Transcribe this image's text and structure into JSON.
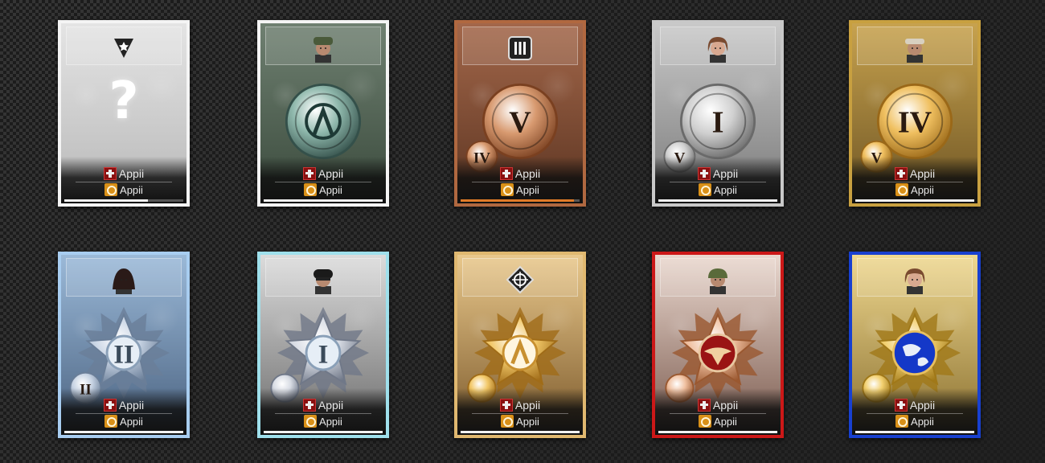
{
  "player_name": "Appii",
  "cards": [
    {
      "id": "unknown",
      "border": "#f4f4f4",
      "bg": [
        "#e4e4e4",
        "#b8b8b8"
      ],
      "header_icon": "faction-star-icon",
      "medal": "unknown",
      "main_numeral": "",
      "sub_numeral": "",
      "question_mark": "?",
      "progress": 0.7,
      "progress_color": "#f2f2f2"
    },
    {
      "id": "green-a",
      "border": "#f4f4f4",
      "bg": [
        "#6f8071",
        "#3a4a3c"
      ],
      "header_icon": "skull-soldier-portrait-icon",
      "medal": "coin-teal",
      "main_numeral": "",
      "sub_numeral": "",
      "progress": 1.0,
      "progress_color": "#f2f2f2"
    },
    {
      "id": "bronze-v",
      "border": "#b06840",
      "bg": [
        "#a3674a",
        "#5c3522"
      ],
      "header_icon": "ammo-icon",
      "medal": "coin-bronze",
      "main_numeral": "V",
      "sub_numeral": "IV",
      "progress": 0.95,
      "progress_color": "#e07a28"
    },
    {
      "id": "silver-i",
      "border": "#c8c8c8",
      "bg": [
        "#c9c9c9",
        "#7a7a7a"
      ],
      "header_icon": "female-soldier-portrait-icon",
      "medal": "coin-silver",
      "main_numeral": "I",
      "sub_numeral": "V",
      "progress": 1.0,
      "progress_color": "#f2f2f2"
    },
    {
      "id": "gold-iv",
      "border": "#c8a040",
      "bg": [
        "#c7a24e",
        "#6e5524"
      ],
      "header_icon": "bandana-soldier-portrait-icon",
      "medal": "coin-gold",
      "main_numeral": "IV",
      "sub_numeral": "V",
      "progress": 1.0,
      "progress_color": "#f2f2f2"
    },
    {
      "id": "blue-ii",
      "border": "#a8cdf0",
      "bg": [
        "#9bb9d8",
        "#4a6280"
      ],
      "header_icon": "hooded-soldier-portrait-icon",
      "medal": "star-silver-blue",
      "main_numeral": "II",
      "sub_numeral": "II",
      "progress": 1.0,
      "progress_color": "#f2f2f2"
    },
    {
      "id": "cyan-i",
      "border": "#9fe0ec",
      "bg": [
        "#dcdcdc",
        "#6c6c6c"
      ],
      "header_icon": "masked-soldier-portrait-icon",
      "medal": "star-silver",
      "main_numeral": "I",
      "sub_numeral": "",
      "progress": 1.0,
      "progress_color": "#f2f2f2"
    },
    {
      "id": "gold-a",
      "border": "#e0b870",
      "bg": [
        "#e9c88c",
        "#7c5a2c"
      ],
      "header_icon": "crosshair-icon",
      "medal": "star-gold",
      "main_numeral": "",
      "sub_numeral": "",
      "progress": 1.0,
      "progress_color": "#f2f2f2"
    },
    {
      "id": "red-eagle",
      "border": "#cc1818",
      "bg": [
        "#ead8cf",
        "#7a5a4e"
      ],
      "header_icon": "helmet-soldier-portrait-icon",
      "medal": "star-red-eagle",
      "main_numeral": "",
      "sub_numeral": "",
      "progress": 1.0,
      "progress_color": "#f2f2f2"
    },
    {
      "id": "blue-globe",
      "border": "#1840d0",
      "bg": [
        "#efd890",
        "#8a7030"
      ],
      "header_icon": "female-portrait-icon",
      "medal": "star-globe",
      "main_numeral": "",
      "sub_numeral": "",
      "progress": 1.0,
      "progress_color": "#f2f2f2"
    }
  ]
}
